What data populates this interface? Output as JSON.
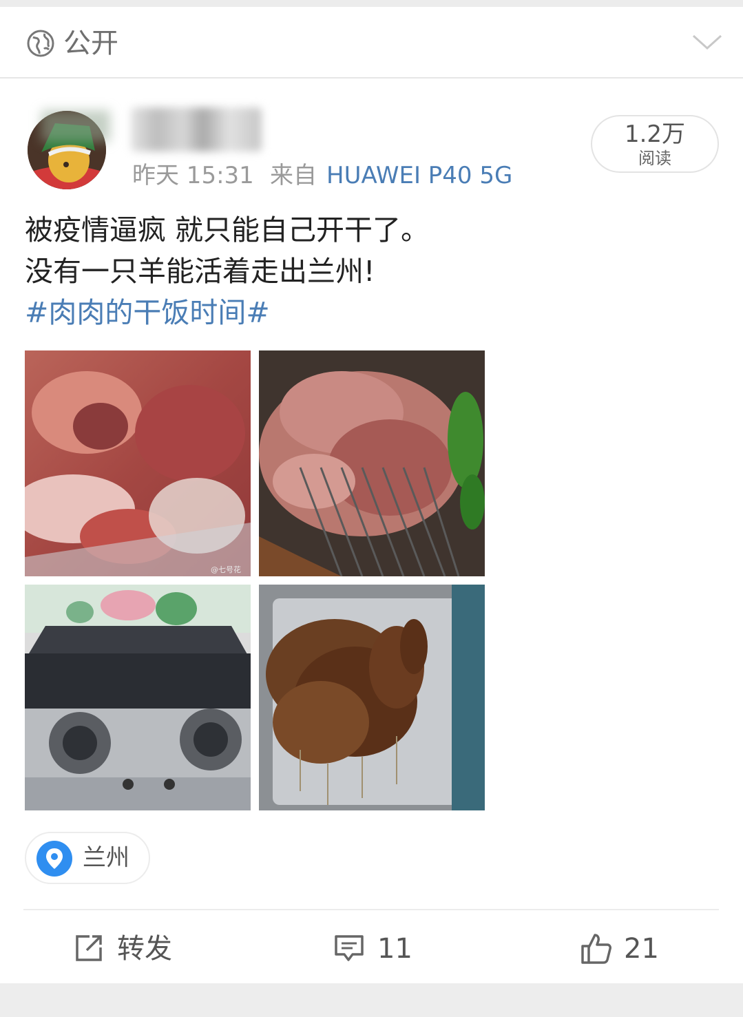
{
  "visibility": {
    "label": "公开"
  },
  "post": {
    "time": "昨天 15:31",
    "source_prefix": "来自",
    "source_device": "HUAWEI P40 5G",
    "read_count": "1.2万",
    "read_label": "阅读",
    "text_lines": [
      "被疫情逼疯 就只能自己开干了。",
      "没有一只羊能活着走出兰州!"
    ],
    "hashtag": "#肉肉的干饭时间#",
    "location": "兰州",
    "photo_watermark": "@七号花"
  },
  "actions": {
    "repost": "转发",
    "comments": "11",
    "likes": "21"
  },
  "colors": {
    "link": "#4a7db5",
    "location_pin": "#2f8ef0"
  }
}
